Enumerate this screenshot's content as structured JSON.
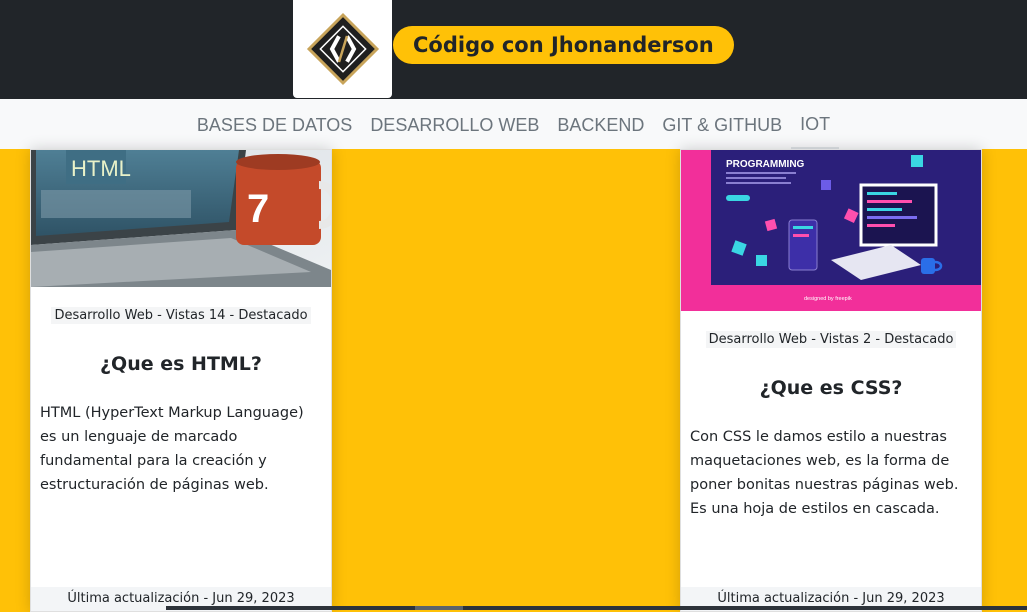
{
  "header": {
    "brand": "Código con Jhonanderson",
    "logo_icon": "diamond-code-logo"
  },
  "nav": {
    "items": [
      {
        "label": "BASES DE DATOS"
      },
      {
        "label": "DESARROLLO WEB"
      },
      {
        "label": "BACKEND"
      },
      {
        "label": "GIT & GITHUB"
      },
      {
        "label": "IOT"
      }
    ]
  },
  "cards": [
    {
      "image_text": "HTML",
      "mug_number": "7",
      "meta": "Desarrollo Web - Vistas 14 - Destacado",
      "title": "¿Que es HTML?",
      "body": "HTML (HyperText Markup Language) es un lenguaje de marcado fundamental para la creación y estructuración de páginas web.",
      "footer": "Última actualización - Jun 29, 2023"
    },
    {
      "image_text": "PROGRAMMING",
      "image_credit": "designed by freepik",
      "meta": "Desarrollo Web - Vistas 2 - Destacado",
      "title": "¿Que es CSS?",
      "body": "Con CSS le damos estilo a nuestras maquetaciones web, es la forma de poner bonitas nuestras páginas web. Es una hoja de estilos en cascada.",
      "footer": "Última actualización - Jun 29, 2023"
    }
  ],
  "colors": {
    "accent": "#ffc107",
    "header_bg": "#212529",
    "illustration_pink": "#f22f9a",
    "illustration_navy": "#2b1f7a"
  }
}
